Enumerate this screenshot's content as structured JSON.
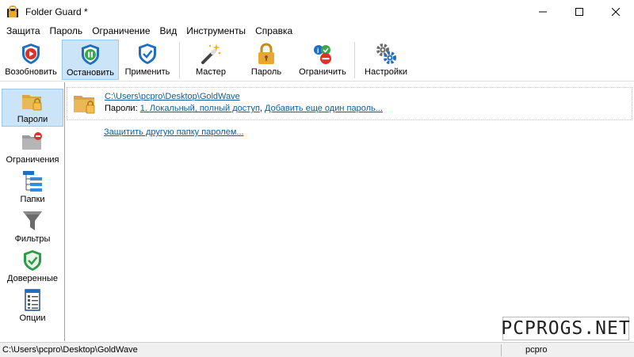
{
  "window": {
    "title": "Folder Guard *",
    "controls": [
      "minimize-icon",
      "maximize-icon",
      "close-icon"
    ]
  },
  "menu": {
    "items": [
      "Защита",
      "Пароль",
      "Ограничение",
      "Вид",
      "Инструменты",
      "Справка"
    ]
  },
  "toolbar": {
    "buttons": [
      {
        "label": "Возобновить",
        "icon": "shield-play-icon",
        "active": false
      },
      {
        "label": "Остановить",
        "icon": "shield-pause-icon",
        "active": true
      },
      {
        "label": "Применить",
        "icon": "shield-check-icon",
        "active": false
      },
      {
        "label": "Мастер",
        "icon": "magic-wand-icon",
        "active": false
      },
      {
        "label": "Пароль",
        "icon": "padlock-icon",
        "active": false
      },
      {
        "label": "Ограничить",
        "icon": "restrict-icon",
        "active": false
      },
      {
        "label": "Настройки",
        "icon": "gears-icon",
        "active": false
      }
    ]
  },
  "sidebar": {
    "items": [
      {
        "label": "Пароли",
        "icon": "locked-folder-icon",
        "active": true
      },
      {
        "label": "Ограничения",
        "icon": "restricted-folder-icon",
        "active": false
      },
      {
        "label": "Папки",
        "icon": "folder-tree-icon",
        "active": false
      },
      {
        "label": "Фильтры",
        "icon": "filter-icon",
        "active": false
      },
      {
        "label": "Доверенные",
        "icon": "trusted-shield-icon",
        "active": false
      },
      {
        "label": "Опции",
        "icon": "options-list-icon",
        "active": false
      }
    ]
  },
  "main": {
    "folder": {
      "path": "C:\\Users\\pcpro\\Desktop\\GoldWave",
      "passwords_label": "Пароли:",
      "password_entry": "1. Локальный, полный доступ",
      "separator": ",",
      "add_password": "Добавить еще один пароль..."
    },
    "protect_other": "Защитить другую папку паролем..."
  },
  "watermark": "PCPROGS.NET",
  "statusbar": {
    "path": "C:\\Users\\pcpro\\Desktop\\GoldWave",
    "user": "pcpro"
  },
  "colors": {
    "accent_selected": "#cce4f7",
    "accent_border": "#99c9ef",
    "link": "#0b5ea8",
    "shield_blue": "#1f6fc1",
    "lock_gold": "#e8a830"
  }
}
